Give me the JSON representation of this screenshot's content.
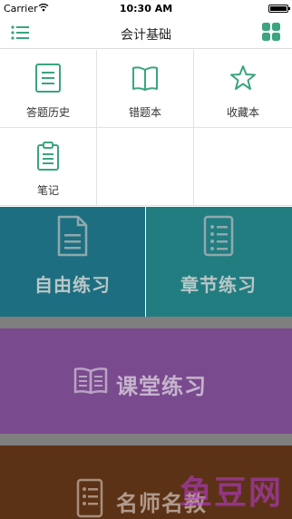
{
  "status_bar": {
    "carrier": "Carrier",
    "time": "10:30 AM"
  },
  "nav": {
    "title": "会计基础",
    "left_icon": "menu-list-icon",
    "right_icon": "grid-apps-icon"
  },
  "tools": [
    {
      "label": "答题历史",
      "icon": "document-lines-icon"
    },
    {
      "label": "错题本",
      "icon": "open-book-icon"
    },
    {
      "label": "收藏本",
      "icon": "star-icon"
    },
    {
      "label": "笔记",
      "icon": "clipboard-icon"
    }
  ],
  "tiles": [
    {
      "label": "自由练习",
      "icon": "document-icon",
      "color": "#1d6e80"
    },
    {
      "label": "章节练习",
      "icon": "list-sheet-icon",
      "color": "#227d80"
    },
    {
      "label": "课堂练习",
      "icon": "book-icon",
      "color": "#7a4a8e"
    },
    {
      "label": "名师名教",
      "icon": "list-sheet-icon",
      "color": "#5c3216"
    }
  ],
  "accent_color": "#3aa57f",
  "watermark": "鱼豆网"
}
